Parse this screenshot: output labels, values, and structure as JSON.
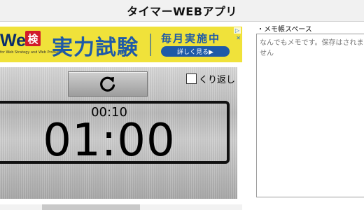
{
  "app": {
    "title": "タイマーWEBアプリ"
  },
  "ad": {
    "brand": "Web",
    "brand_kanji": "検",
    "tagline": "for Web Strategy and Web Production",
    "headline": "実力試験",
    "monthly": "毎月実施中",
    "detail": "詳しく見る▶",
    "adchoice": "▷",
    "close": "✕",
    "bg_color": "#f0e23a",
    "accent_color": "#1f5aa7"
  },
  "timer": {
    "reset_icon": "reset-icon",
    "repeat_label": "くり返し",
    "repeat_checked": false,
    "elapsed": "00:10",
    "countdown": "01:00"
  },
  "memo": {
    "label": "・メモ帳スペース",
    "placeholder": "なんでもメモです。保存はされません"
  }
}
